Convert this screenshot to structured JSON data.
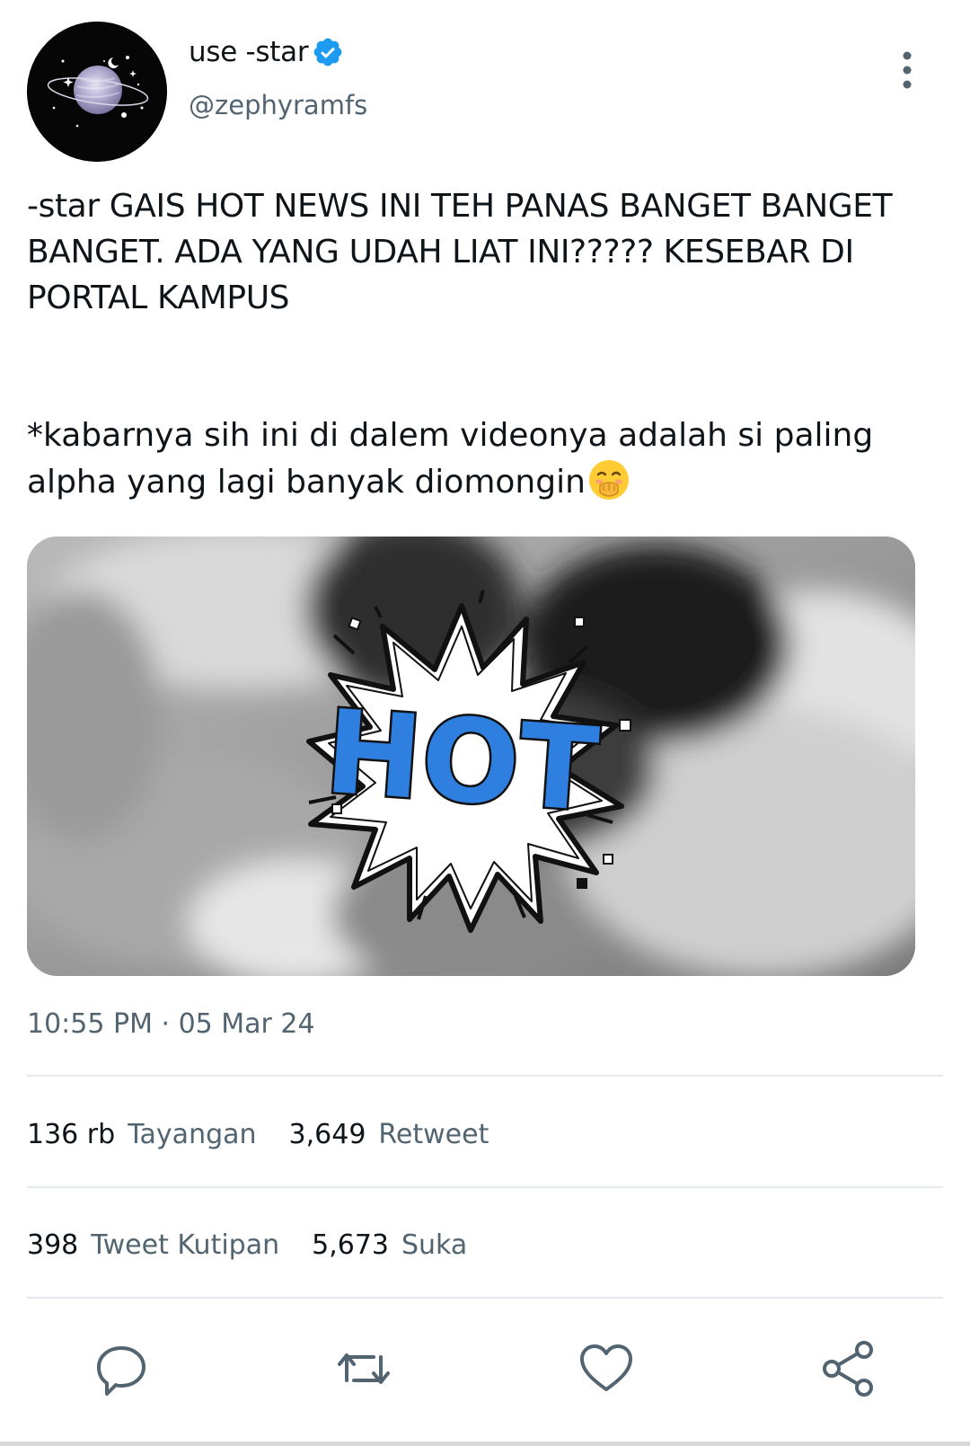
{
  "user": {
    "display_name": "use -star",
    "handle": "@zephyramfs"
  },
  "tweet": {
    "text_line1": "-star GAIS HOT NEWS INI TEH PANAS BANGET BANGET BANGET. ADA YANG UDAH LIAT INI????? KESEBAR DI PORTAL KAMPUS",
    "text_line2": "*kabarnya sih ini di dalem videonya adalah si paling alpha yang lagi banyak diomongin",
    "media_sticker_text": "HOT",
    "timestamp": "10:55 PM · 05 Mar 24"
  },
  "stats": {
    "views_count": "136 rb",
    "views_label": "Tayangan",
    "retweets_count": "3,649",
    "retweets_label": "Retweet",
    "quotes_count": "398",
    "quotes_label": "Tweet Kutipan",
    "likes_count": "5,673",
    "likes_label": "Suka"
  },
  "colors": {
    "verified": "#1d9bf0",
    "secondary_text": "#536471",
    "divider": "#e6e9eb",
    "icon": "#536471",
    "sticker_blue": "#2f7fe0"
  },
  "icons": {
    "more": "more-vertical-icon",
    "verified": "verified-badge-icon",
    "reply": "reply-icon",
    "retweet": "retweet-icon",
    "like": "heart-icon",
    "share": "share-icon",
    "emoji": "face-with-hand-over-mouth-emoji"
  }
}
